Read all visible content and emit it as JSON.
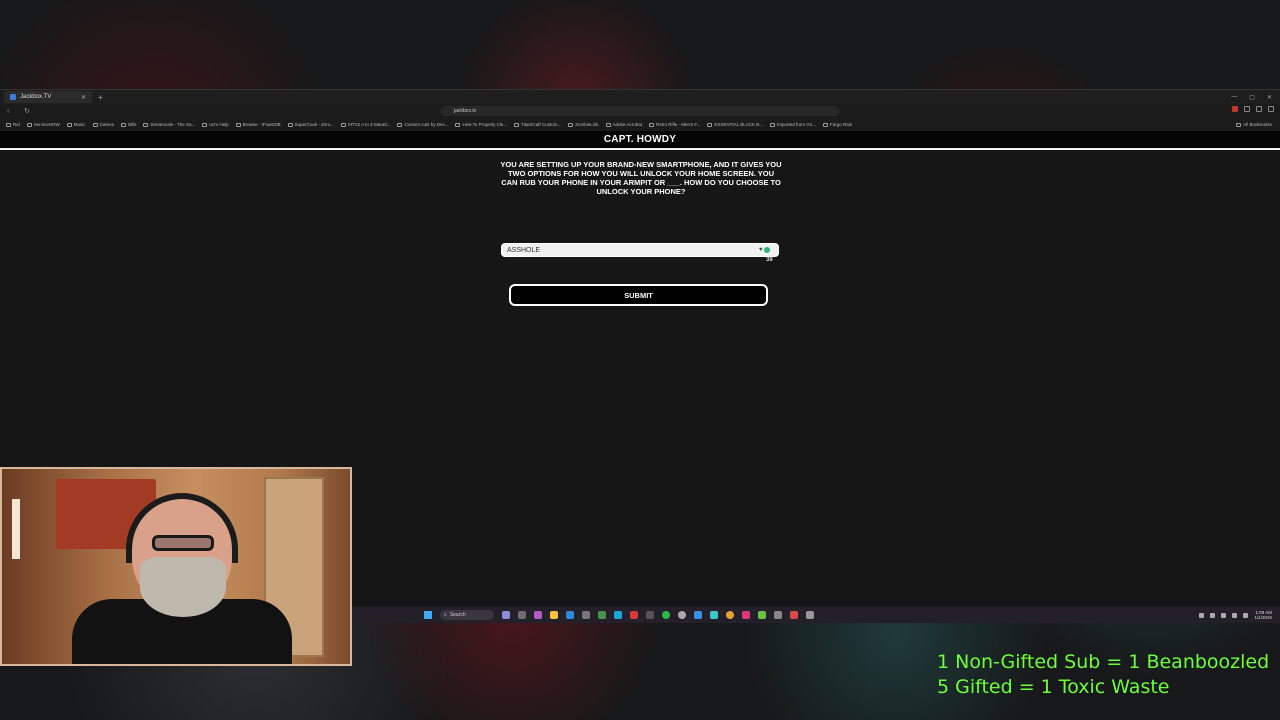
{
  "browser": {
    "tab_title": "Jackbox.TV",
    "url": "jackbox.tv",
    "bookmarks": [
      "Rel",
      "ServiceNOW",
      "Music",
      "Games",
      "Bills",
      "Streamcats - The Sa...",
      "Un's Help",
      "Browse - IFoamDB",
      "SuperCook - Zero...",
      "MTV2 A to Z Maratl...",
      "Custom cuts by Des...",
      "How To Properly Cle...",
      "TitanCraft Custom...",
      "ZombieLink",
      "Adobe Acrobat",
      "Retro Rifle - Men's F...",
      "ESSENTIAL BLACK B...",
      "Imported from Go...",
      "Fargo Rain"
    ],
    "bookmarks_right": "All Bookmarks"
  },
  "game": {
    "player_name": "CAPT. HOWDY",
    "prompt": "YOU ARE SETTING UP YOUR BRAND-NEW SMARTPHONE, AND IT GIVES YOU TWO OPTIONS FOR HOW YOU WILL UNLOCK YOUR HOME SCREEN. YOU CAN RUB YOUR PHONE IN YOUR ARMPIT OR ___. HOW DO YOU CHOOSE TO UNLOCK YOUR PHONE?",
    "answer_value": "ASSHOLE",
    "char_count": "38",
    "submit_label": "SUBMIT"
  },
  "taskbar": {
    "search_label": "Search",
    "time": "1:09 AM",
    "date": "1/1/2026"
  },
  "overlay": {
    "goal_line_1": "1 Non-Gifted Sub = 1 Beanboozled",
    "goal_line_2": "5 Gifted = 1 Toxic Waste"
  },
  "colors": {
    "goal_text": "#6cff3a",
    "header_bg": "#050505",
    "content_bg": "#161616"
  }
}
